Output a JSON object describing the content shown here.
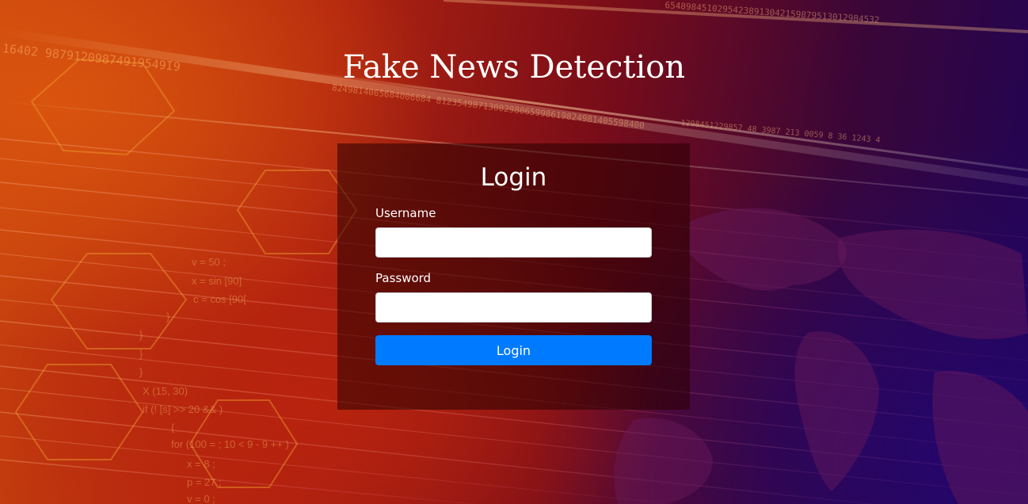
{
  "page": {
    "title": "Fake News Detection"
  },
  "login_form": {
    "heading": "Login",
    "username_label": "Username",
    "username_value": "",
    "password_label": "Password",
    "password_value": "",
    "submit_label": "Login"
  },
  "background": {
    "code_lines": [
      "v = 50 ;",
      "x = sin [90]",
      "c = cos [90[",
      "}",
      "}",
      "}",
      "}",
      "X (15, 30)",
      "if (! [s] >> 20 && )",
      "{",
      "for (100 = ; 10 < 9 - 9 ++ )",
      "x = 8 ;",
      "p = 27 ;",
      "v = 0 ;"
    ],
    "digit_strings": [
      "16402 98791209874919549I9",
      "8249814065684006684 8123549871300298065998619824981405598400",
      "65489845102954238913042159879513012984532",
      "1298451229857 48 3987 213 0059 8 36 1243 4"
    ]
  },
  "colors": {
    "accent": "#007bff",
    "panel": "rgba(40,0,0,0.55)",
    "text": "#ffffff"
  }
}
